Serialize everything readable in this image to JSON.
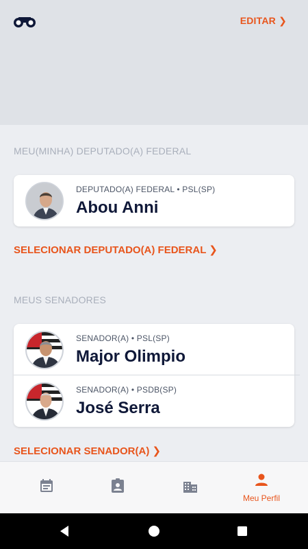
{
  "header": {
    "edit_label": "EDITAR ❯",
    "logo_icon": "binoculars-icon"
  },
  "deputy_section": {
    "title": "MEU(MINHA) DEPUTADO(A) FEDERAL",
    "items": [
      {
        "role": "DEPUTADO(A) FEDERAL • PSL(SP)",
        "name": "Abou Anni"
      }
    ],
    "select_label": "SELECIONAR DEPUTADO(A) FEDERAL ❯"
  },
  "senators_section": {
    "title": "MEUS SENADORES",
    "items": [
      {
        "role": "SENADOR(A) • PSL(SP)",
        "name": "Major Olimpio"
      },
      {
        "role": "SENADOR(A) • PSDB(SP)",
        "name": "José Serra"
      }
    ],
    "select_label": "SELECIONAR SENADOR(A) ❯"
  },
  "bottom_nav": {
    "items": [
      {
        "icon": "calendar-icon",
        "label": ""
      },
      {
        "icon": "clipboard-profile-icon",
        "label": ""
      },
      {
        "icon": "building-icon",
        "label": ""
      },
      {
        "icon": "person-icon",
        "label": "Meu Perfil",
        "active": true
      }
    ]
  },
  "colors": {
    "accent": "#e8551c",
    "inactive_icon": "#7b8190",
    "name_text": "#0f1838"
  }
}
